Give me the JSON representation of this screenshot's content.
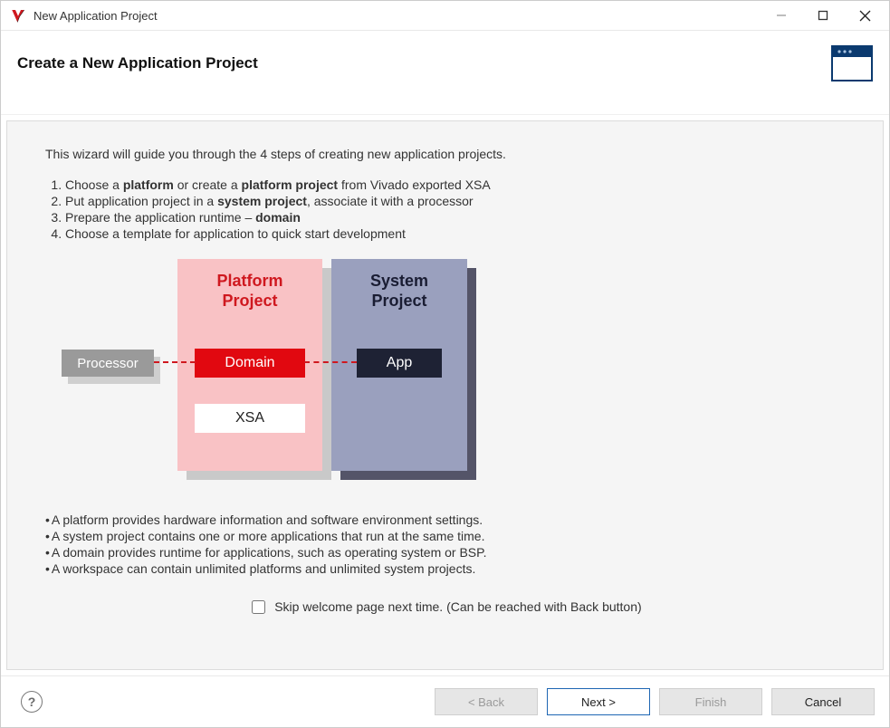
{
  "window": {
    "title": "New Application Project"
  },
  "header": {
    "title": "Create a New Application Project"
  },
  "wizard": {
    "intro": "This wizard will guide you through the 4 steps of creating new application projects.",
    "steps": {
      "s1_a": "Choose a ",
      "s1_b": "platform",
      "s1_c": " or create a ",
      "s1_d": "platform project",
      "s1_e": " from Vivado exported XSA",
      "s2_a": "Put application project in a ",
      "s2_b": "system project",
      "s2_c": ", associate it with a processor",
      "s3_a": "Prepare the application runtime – ",
      "s3_b": "domain",
      "s4": "Choose a template for application to quick start development"
    }
  },
  "diagram": {
    "processor": "Processor",
    "platform_title_l1": "Platform",
    "platform_title_l2": "Project",
    "domain": "Domain",
    "xsa": "XSA",
    "system_title_l1": "System",
    "system_title_l2": "Project",
    "app": "App"
  },
  "notes": {
    "n1": "A platform provides hardware information and software environment settings.",
    "n2": "A system project contains one or more applications that run at the same time.",
    "n3": "A domain provides runtime for applications, such as operating system or BSP.",
    "n4": "A workspace can contain unlimited platforms and unlimited system projects."
  },
  "skip": {
    "label": "Skip welcome page next time. (Can be reached with Back button)",
    "checked": false
  },
  "buttons": {
    "back": "< Back",
    "next": "Next >",
    "finish": "Finish",
    "cancel": "Cancel"
  }
}
